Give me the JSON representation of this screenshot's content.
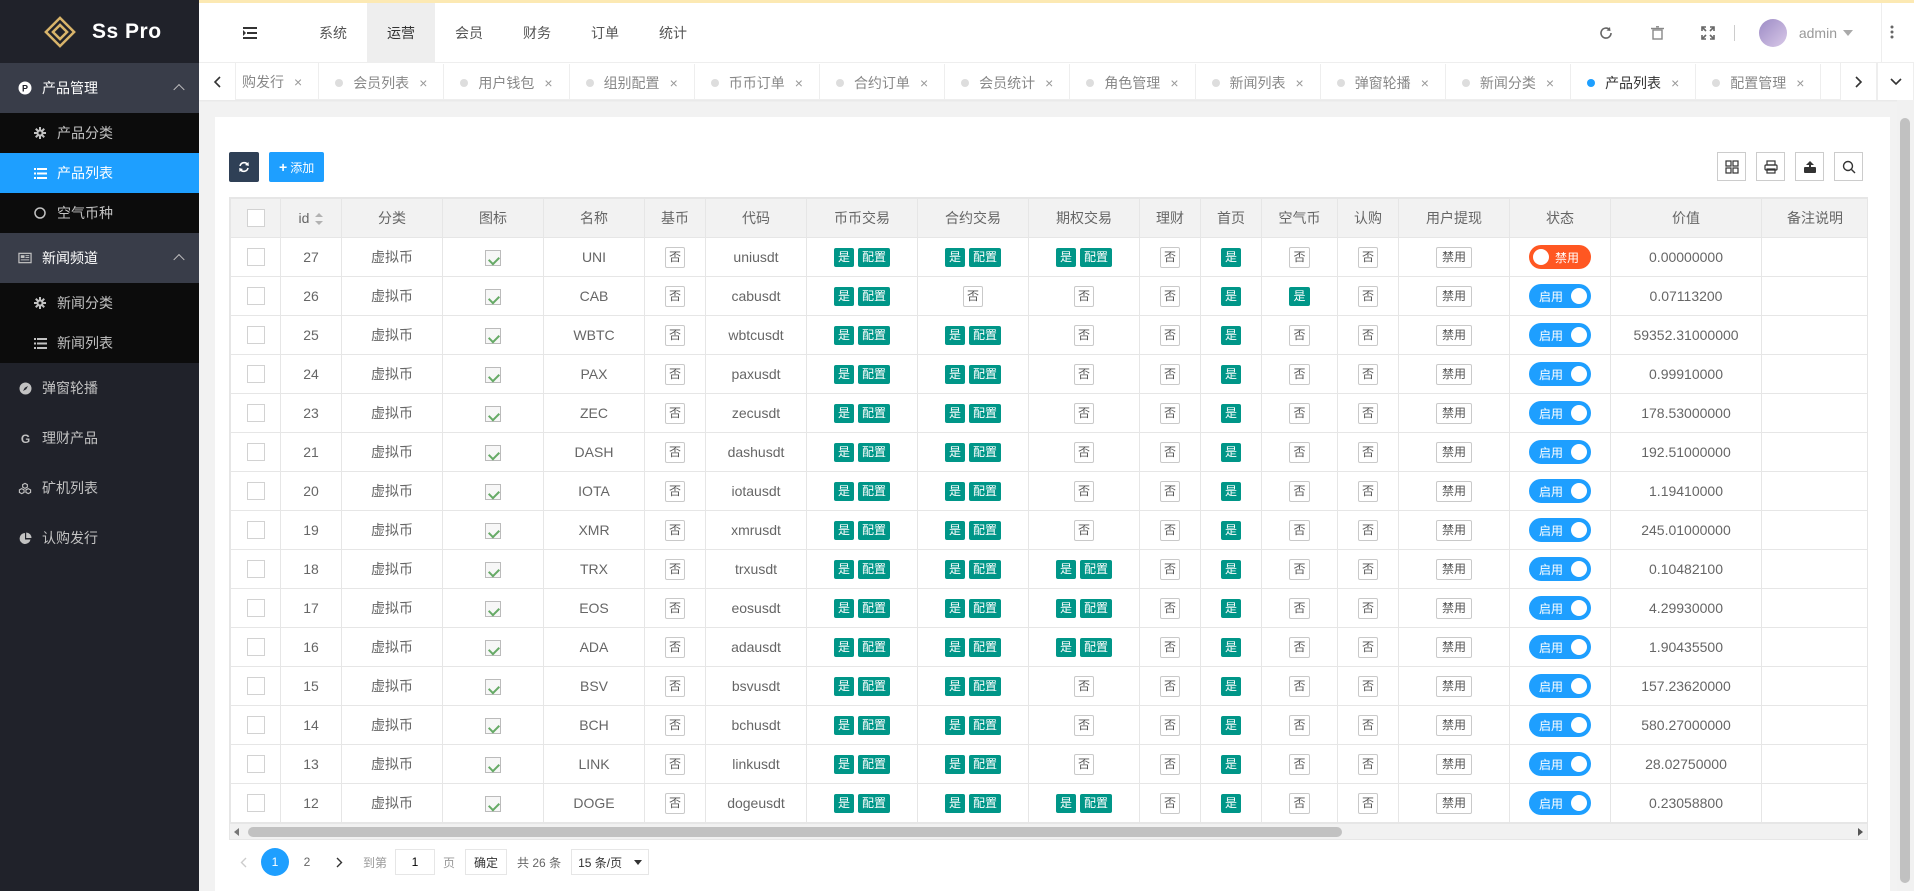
{
  "app": {
    "title": "Ss Pro"
  },
  "sidebar": {
    "groups": [
      {
        "label": "产品管理",
        "icon": "product-circle-icon",
        "children": [
          {
            "label": "产品分类",
            "icon": "gear-icon",
            "active": false
          },
          {
            "label": "产品列表",
            "icon": "list-icon",
            "active": true
          },
          {
            "label": "空气币种",
            "icon": "circle-icon",
            "active": false
          }
        ]
      },
      {
        "label": "新闻频道",
        "icon": "newspaper-icon",
        "children": [
          {
            "label": "新闻分类",
            "icon": "gear-icon",
            "active": false
          },
          {
            "label": "新闻列表",
            "icon": "list-icon",
            "active": false
          }
        ]
      }
    ],
    "items": [
      {
        "label": "弹窗轮播",
        "icon": "compass-icon"
      },
      {
        "label": "理财产品",
        "icon": "g-icon"
      },
      {
        "label": "矿机列表",
        "icon": "cubes-icon"
      },
      {
        "label": "认购发行",
        "icon": "pie-chart-icon"
      }
    ]
  },
  "topnav": {
    "items": [
      "系统",
      "运营",
      "会员",
      "财务",
      "订单",
      "统计"
    ],
    "active": "运营",
    "user": "admin"
  },
  "tabs": {
    "items": [
      "购发行",
      "会员列表",
      "用户钱包",
      "组别配置",
      "币币订单",
      "合约订单",
      "会员统计",
      "角色管理",
      "新闻列表",
      "弹窗轮播",
      "新闻分类",
      "产品列表",
      "配置管理"
    ],
    "active": "产品列表"
  },
  "toolbar": {
    "add_label": "添加"
  },
  "table": {
    "columns": [
      "id",
      "分类",
      "图标",
      "名称",
      "基币",
      "代码",
      "币币交易",
      "合约交易",
      "期权交易",
      "理财",
      "首页",
      "空气币",
      "认购",
      "用户提现",
      "状态",
      "价值",
      "备注说明"
    ],
    "labels": {
      "yes": "是",
      "no": "否",
      "config": "配置",
      "disable": "禁用",
      "on": "启用",
      "off": "禁用"
    },
    "rows": [
      {
        "id": "27",
        "cat": "虚拟币",
        "name": "UNI",
        "code": "uniusdt",
        "spot": true,
        "contract": true,
        "option": true,
        "air": false,
        "status": false,
        "value": "0.00000000"
      },
      {
        "id": "26",
        "cat": "虚拟币",
        "name": "CAB",
        "code": "cabusdt",
        "spot": true,
        "contract": false,
        "option": false,
        "air": true,
        "status": true,
        "value": "0.07113200"
      },
      {
        "id": "25",
        "cat": "虚拟币",
        "name": "WBTC",
        "code": "wbtcusdt",
        "spot": true,
        "contract": true,
        "option": false,
        "air": false,
        "status": true,
        "value": "59352.31000000"
      },
      {
        "id": "24",
        "cat": "虚拟币",
        "name": "PAX",
        "code": "paxusdt",
        "spot": true,
        "contract": true,
        "option": false,
        "air": false,
        "status": true,
        "value": "0.99910000"
      },
      {
        "id": "23",
        "cat": "虚拟币",
        "name": "ZEC",
        "code": "zecusdt",
        "spot": true,
        "contract": true,
        "option": false,
        "air": false,
        "status": true,
        "value": "178.53000000"
      },
      {
        "id": "21",
        "cat": "虚拟币",
        "name": "DASH",
        "code": "dashusdt",
        "spot": true,
        "contract": true,
        "option": false,
        "air": false,
        "status": true,
        "value": "192.51000000"
      },
      {
        "id": "20",
        "cat": "虚拟币",
        "name": "IOTA",
        "code": "iotausdt",
        "spot": true,
        "contract": true,
        "option": false,
        "air": false,
        "status": true,
        "value": "1.19410000"
      },
      {
        "id": "19",
        "cat": "虚拟币",
        "name": "XMR",
        "code": "xmrusdt",
        "spot": true,
        "contract": true,
        "option": false,
        "air": false,
        "status": true,
        "value": "245.01000000"
      },
      {
        "id": "18",
        "cat": "虚拟币",
        "name": "TRX",
        "code": "trxusdt",
        "spot": true,
        "contract": true,
        "option": true,
        "air": false,
        "status": true,
        "value": "0.10482100"
      },
      {
        "id": "17",
        "cat": "虚拟币",
        "name": "EOS",
        "code": "eosusdt",
        "spot": true,
        "contract": true,
        "option": true,
        "air": false,
        "status": true,
        "value": "4.29930000"
      },
      {
        "id": "16",
        "cat": "虚拟币",
        "name": "ADA",
        "code": "adausdt",
        "spot": true,
        "contract": true,
        "option": true,
        "air": false,
        "status": true,
        "value": "1.90435500"
      },
      {
        "id": "15",
        "cat": "虚拟币",
        "name": "BSV",
        "code": "bsvusdt",
        "spot": true,
        "contract": true,
        "option": false,
        "air": false,
        "status": true,
        "value": "157.23620000"
      },
      {
        "id": "14",
        "cat": "虚拟币",
        "name": "BCH",
        "code": "bchusdt",
        "spot": true,
        "contract": true,
        "option": false,
        "air": false,
        "status": true,
        "value": "580.27000000"
      },
      {
        "id": "13",
        "cat": "虚拟币",
        "name": "LINK",
        "code": "linkusdt",
        "spot": true,
        "contract": true,
        "option": false,
        "air": false,
        "status": true,
        "value": "28.02750000"
      },
      {
        "id": "12",
        "cat": "虚拟币",
        "name": "DOGE",
        "code": "dogeusdt",
        "spot": true,
        "contract": true,
        "option": true,
        "air": false,
        "status": true,
        "value": "0.23058800"
      }
    ]
  },
  "pager": {
    "pages": [
      "1",
      "2"
    ],
    "current": "1",
    "goto_label": "到第",
    "goto_value": "1",
    "page_label": "页",
    "ok_label": "确定",
    "total_label": "共 26 条",
    "per_page": "15 条/页"
  },
  "colors": {
    "accent": "#1e9fff",
    "green": "#009688",
    "sidebar": "#20222a",
    "danger": "#ff5722"
  }
}
